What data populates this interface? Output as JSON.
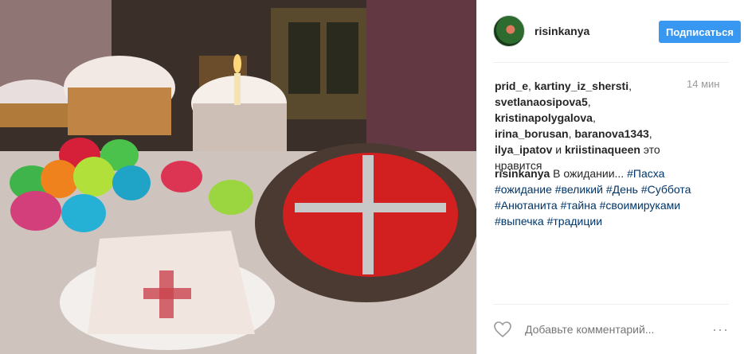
{
  "post": {
    "username": "risinkanya",
    "follow_label": "Подписаться",
    "time": "14 мин",
    "likes": {
      "users": [
        "prid_e",
        "kartiny_iz_shersti",
        "svetlanaosipova5",
        "kristinapolygalova",
        "irina_borusan",
        "baranova1343",
        "ilya_ipatov",
        "kriistinaqueen"
      ],
      "and_word": "и",
      "suffix": "это нравится"
    },
    "caption": {
      "user": "risinkanya",
      "text": "В ожидании...",
      "tags": [
        "#Пасха",
        "#ожидание",
        "#великий",
        "#День",
        "#Суббота",
        "#Анютанита",
        "#тайна",
        "#своимируками",
        "#выпечка",
        "#традиции"
      ]
    },
    "comment_placeholder": "Добавьте комментарий...",
    "more_label": "···"
  },
  "colors": {
    "accent": "#3897f0",
    "link": "#003569",
    "muted": "#999999"
  },
  "icons": {
    "heart": "heart-icon",
    "more": "more-icon"
  }
}
